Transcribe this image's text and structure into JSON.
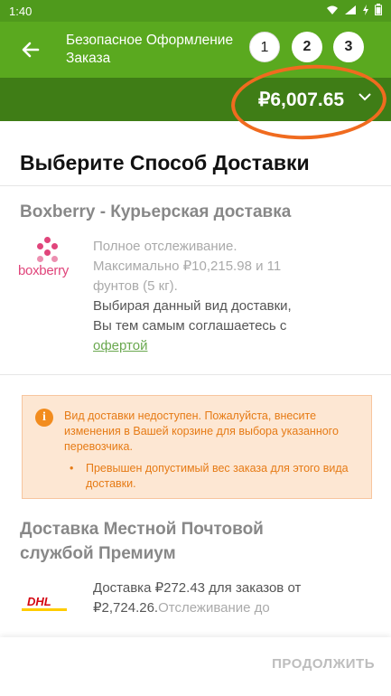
{
  "status_bar": {
    "time": "1:40",
    "icons": [
      "wifi-icon",
      "signal-icon",
      "charging-icon",
      "battery-icon"
    ]
  },
  "header": {
    "title": "Безопасное Оформление Заказа",
    "steps": [
      "1",
      "2",
      "3"
    ],
    "current_step": 3
  },
  "price_bar": {
    "total": "₽6,007.65"
  },
  "page": {
    "section_title": "Выберите Способ Доставки"
  },
  "boxberry": {
    "title": "Boxberry - Курьерская доставка",
    "logo_text": "boxberry",
    "desc_muted": "Полное отслеживание. Максимально ₽10,215.98 и 11 фунтов (5 кг).",
    "desc_main": "Выбирая данный вид доставки, Вы тем самым соглашаетесь с ",
    "offer_link": "офертой"
  },
  "alert": {
    "message": "Вид доставки недоступен. Пожалуйста, внесите изменения в Вашей корзине для выбора указанного перевозчика.",
    "bullet": "Превышен допустимый вес заказа для этого вида доставки."
  },
  "premium": {
    "title": "Доставка Местной Почтовой службой Премиум",
    "logo_text": "DHL",
    "desc_main": "Доставка ₽272.43 для заказов от ₽2,724.26.",
    "desc_muted": "Отслеживание до"
  },
  "footer": {
    "continue_label": "ПРОДОЛЖИТЬ"
  },
  "colors": {
    "header_green": "#5aa91f",
    "price_bar_green": "#3f7d16",
    "alert_orange": "#e67b16",
    "brand_pink": "#e0457b",
    "annotation_orange": "#f06b1f"
  }
}
